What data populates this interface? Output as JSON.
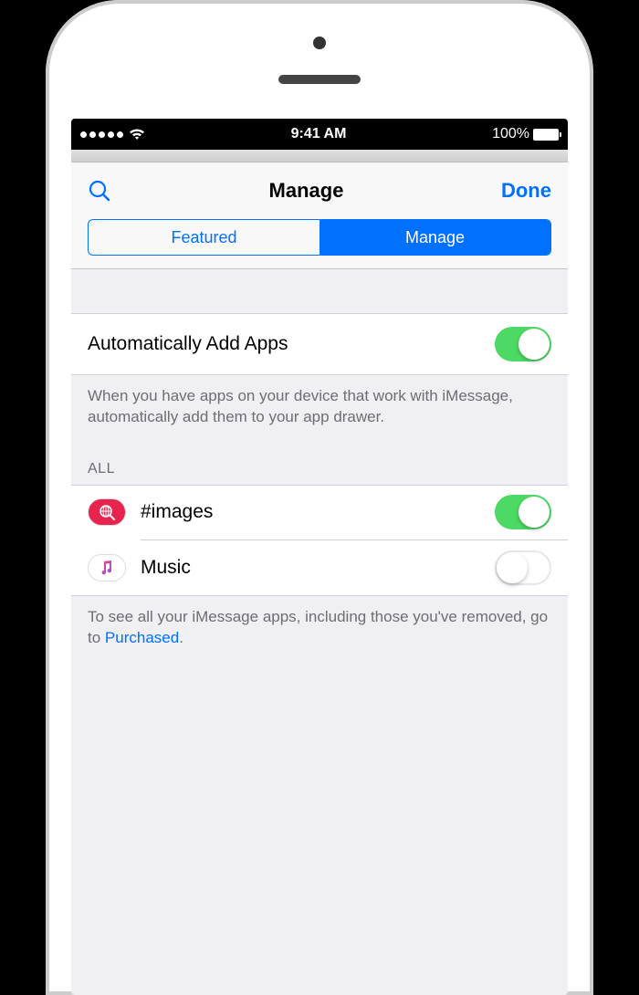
{
  "status": {
    "time": "9:41 AM",
    "battery_pct": "100%"
  },
  "nav": {
    "title": "Manage",
    "done": "Done"
  },
  "segments": {
    "featured": "Featured",
    "manage": "Manage"
  },
  "auto_add": {
    "label": "Automatically Add Apps",
    "enabled": true,
    "footer": "When you have apps on your device that work with iMessage, automatically add them to your app drawer."
  },
  "all": {
    "header": "ALL",
    "apps": [
      {
        "name": "#images",
        "enabled": true,
        "icon": "images-icon"
      },
      {
        "name": "Music",
        "enabled": false,
        "icon": "music-icon"
      }
    ],
    "footer_prefix": "To see all your iMessage apps, including those you've removed, go to ",
    "footer_link": "Purchased",
    "footer_suffix": "."
  }
}
